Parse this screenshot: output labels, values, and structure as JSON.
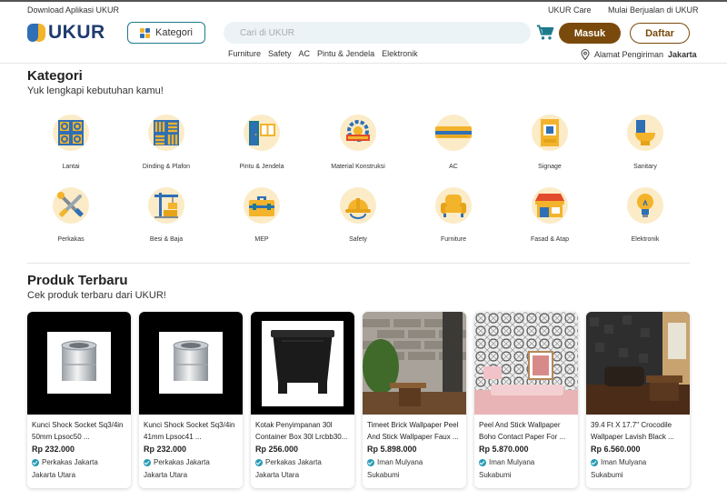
{
  "topbar": {
    "download": "Download Aplikasi UKUR",
    "care": "UKUR Care",
    "sell": "Mulai Berjualan di UKUR"
  },
  "header": {
    "logo": "UKUR",
    "kategori_label": "Kategori",
    "search_placeholder": "Cari di UKUR",
    "login_label": "Masuk",
    "register_label": "Daftar",
    "quicknav": [
      "Furniture",
      "Safety",
      "AC",
      "Pintu & Jendela",
      "Elektronik"
    ],
    "address_prefix": "Alamat Pengiriman",
    "address_city": "Jakarta"
  },
  "categories": {
    "title": "Kategori",
    "subtitle": "Yuk lengkapi kebutuhan kamu!",
    "items": [
      {
        "label": "Lantai",
        "icon": "floor-tiles-icon"
      },
      {
        "label": "Dinding & Plafon",
        "icon": "wall-panel-icon"
      },
      {
        "label": "Pintu & Jendela",
        "icon": "door-window-icon"
      },
      {
        "label": "Material Konstruksi",
        "icon": "construction-material-icon"
      },
      {
        "label": "AC",
        "icon": "air-conditioner-icon"
      },
      {
        "label": "Signage",
        "icon": "signage-icon"
      },
      {
        "label": "Sanitary",
        "icon": "toilet-icon"
      },
      {
        "label": "Perkakas",
        "icon": "tools-icon"
      },
      {
        "label": "Besi & Baja",
        "icon": "steel-crane-icon"
      },
      {
        "label": "MEP",
        "icon": "toolbox-icon"
      },
      {
        "label": "Safety",
        "icon": "hard-hat-icon"
      },
      {
        "label": "Furniture",
        "icon": "armchair-icon"
      },
      {
        "label": "Fasad & Atap",
        "icon": "storefront-icon"
      },
      {
        "label": "Elektronik",
        "icon": "light-bulb-icon"
      }
    ]
  },
  "products": {
    "title": "Produk Terbaru",
    "subtitle": "Cek produk terbaru dari UKUR!",
    "items": [
      {
        "name": "Kunci Shock Socket Sq3/4in 50mm Lpsoc50 ...",
        "price": "Rp 232.000",
        "seller": "Perkakas Jakarta",
        "location": "Jakarta Utara"
      },
      {
        "name": "Kunci Shock Socket Sq3/4in 41mm Lpsoc41 ...",
        "price": "Rp 232.000",
        "seller": "Perkakas Jakarta",
        "location": "Jakarta Utara"
      },
      {
        "name": "Kotak Penyimpanan 30l Container Box 30l Lrcbb30...",
        "price": "Rp 256.000",
        "seller": "Perkakas Jakarta",
        "location": "Jakarta Utara"
      },
      {
        "name": "Timeet Brick Wallpaper Peel And Stick Wallpaper Faux ...",
        "price": "Rp 5.898.000",
        "seller": "Iman Mulyana",
        "location": "Sukabumi"
      },
      {
        "name": "Peel And Stick Wallpaper Boho Contact Paper For ...",
        "price": "Rp 5.870.000",
        "seller": "Iman Mulyana",
        "location": "Sukabumi"
      },
      {
        "name": "39.4 Ft X 17.7\" Crocodile Wallpaper Lavish Black ...",
        "price": "Rp 6.560.000",
        "seller": "Iman Mulyana",
        "location": "Sukabumi"
      }
    ]
  },
  "colors": {
    "brand_blue": "#1f3b6e",
    "brand_yellow": "#f3b32b",
    "primary_brown": "#7a4a0c",
    "teal": "#1d7a8c",
    "category_bg": "#fbebc7"
  }
}
